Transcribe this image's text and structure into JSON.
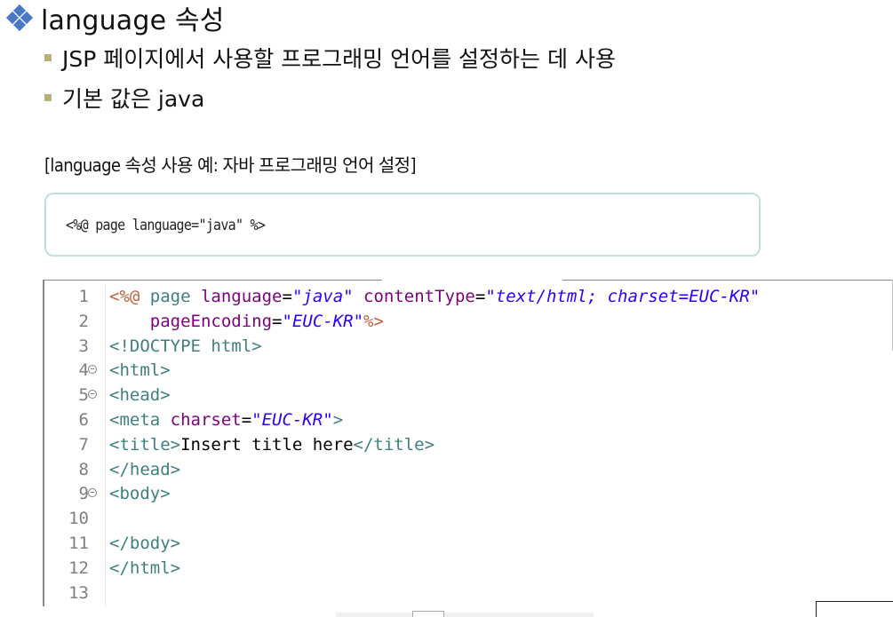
{
  "heading": {
    "text": "language 속성"
  },
  "bullets": [
    "JSP 페이지에서 사용할 프로그래밍 언어를 설정하는 데 사용",
    "기본 값은 java"
  ],
  "caption": "[language 속성 사용 예: 자바 프로그래밍 언어 설정]",
  "example_code": "<%@ page language=\"java\" %>",
  "editor": {
    "line_numbers": [
      "1",
      "2",
      "3",
      "4",
      "5",
      "6",
      "7",
      "8",
      "9",
      "10",
      "11",
      "12",
      "13"
    ],
    "lines": [
      [
        {
          "t": "<%@",
          "c": "t-dir"
        },
        {
          "t": " page ",
          "c": "t-tag"
        },
        {
          "t": "language",
          "c": "t-attr"
        },
        {
          "t": "=",
          "c": "t-plain"
        },
        {
          "t": "\"java\"",
          "c": "t-str"
        },
        {
          "t": " ",
          "c": "t-plain"
        },
        {
          "t": "contentType",
          "c": "t-attr"
        },
        {
          "t": "=",
          "c": "t-plain"
        },
        {
          "t": "\"text/html; charset=EUC-KR\"",
          "c": "t-str"
        }
      ],
      [
        {
          "t": "    ",
          "c": "t-plain"
        },
        {
          "t": "pageEncoding",
          "c": "t-attr"
        },
        {
          "t": "=",
          "c": "t-plain"
        },
        {
          "t": "\"EUC-KR\"",
          "c": "t-str"
        },
        {
          "t": "%>",
          "c": "t-dir"
        }
      ],
      [
        {
          "t": "<!DOCTYPE html>",
          "c": "t-tag"
        }
      ],
      [
        {
          "t": "<html>",
          "c": "t-tag"
        }
      ],
      [
        {
          "t": "<head>",
          "c": "t-tag"
        }
      ],
      [
        {
          "t": "<meta ",
          "c": "t-tag"
        },
        {
          "t": "charset",
          "c": "t-attr"
        },
        {
          "t": "=",
          "c": "t-plain"
        },
        {
          "t": "\"EUC-KR\"",
          "c": "t-str"
        },
        {
          "t": ">",
          "c": "t-tag"
        }
      ],
      [
        {
          "t": "<title>",
          "c": "t-tag"
        },
        {
          "t": "Insert title here",
          "c": "t-plain"
        },
        {
          "t": "</title>",
          "c": "t-tag"
        }
      ],
      [
        {
          "t": "</head>",
          "c": "t-tag"
        }
      ],
      [
        {
          "t": "<body>",
          "c": "t-tag"
        }
      ],
      [],
      [
        {
          "t": "</body>",
          "c": "t-tag"
        }
      ],
      [
        {
          "t": "</html>",
          "c": "t-tag"
        }
      ],
      []
    ],
    "foldable_lines": [
      4,
      5,
      9
    ],
    "colors": {
      "tag": "#3f7f7f",
      "directive": "#bf5f3f",
      "attribute": "#7f007f",
      "string": "#2a00ff",
      "line_number": "#7f7f7f"
    }
  }
}
